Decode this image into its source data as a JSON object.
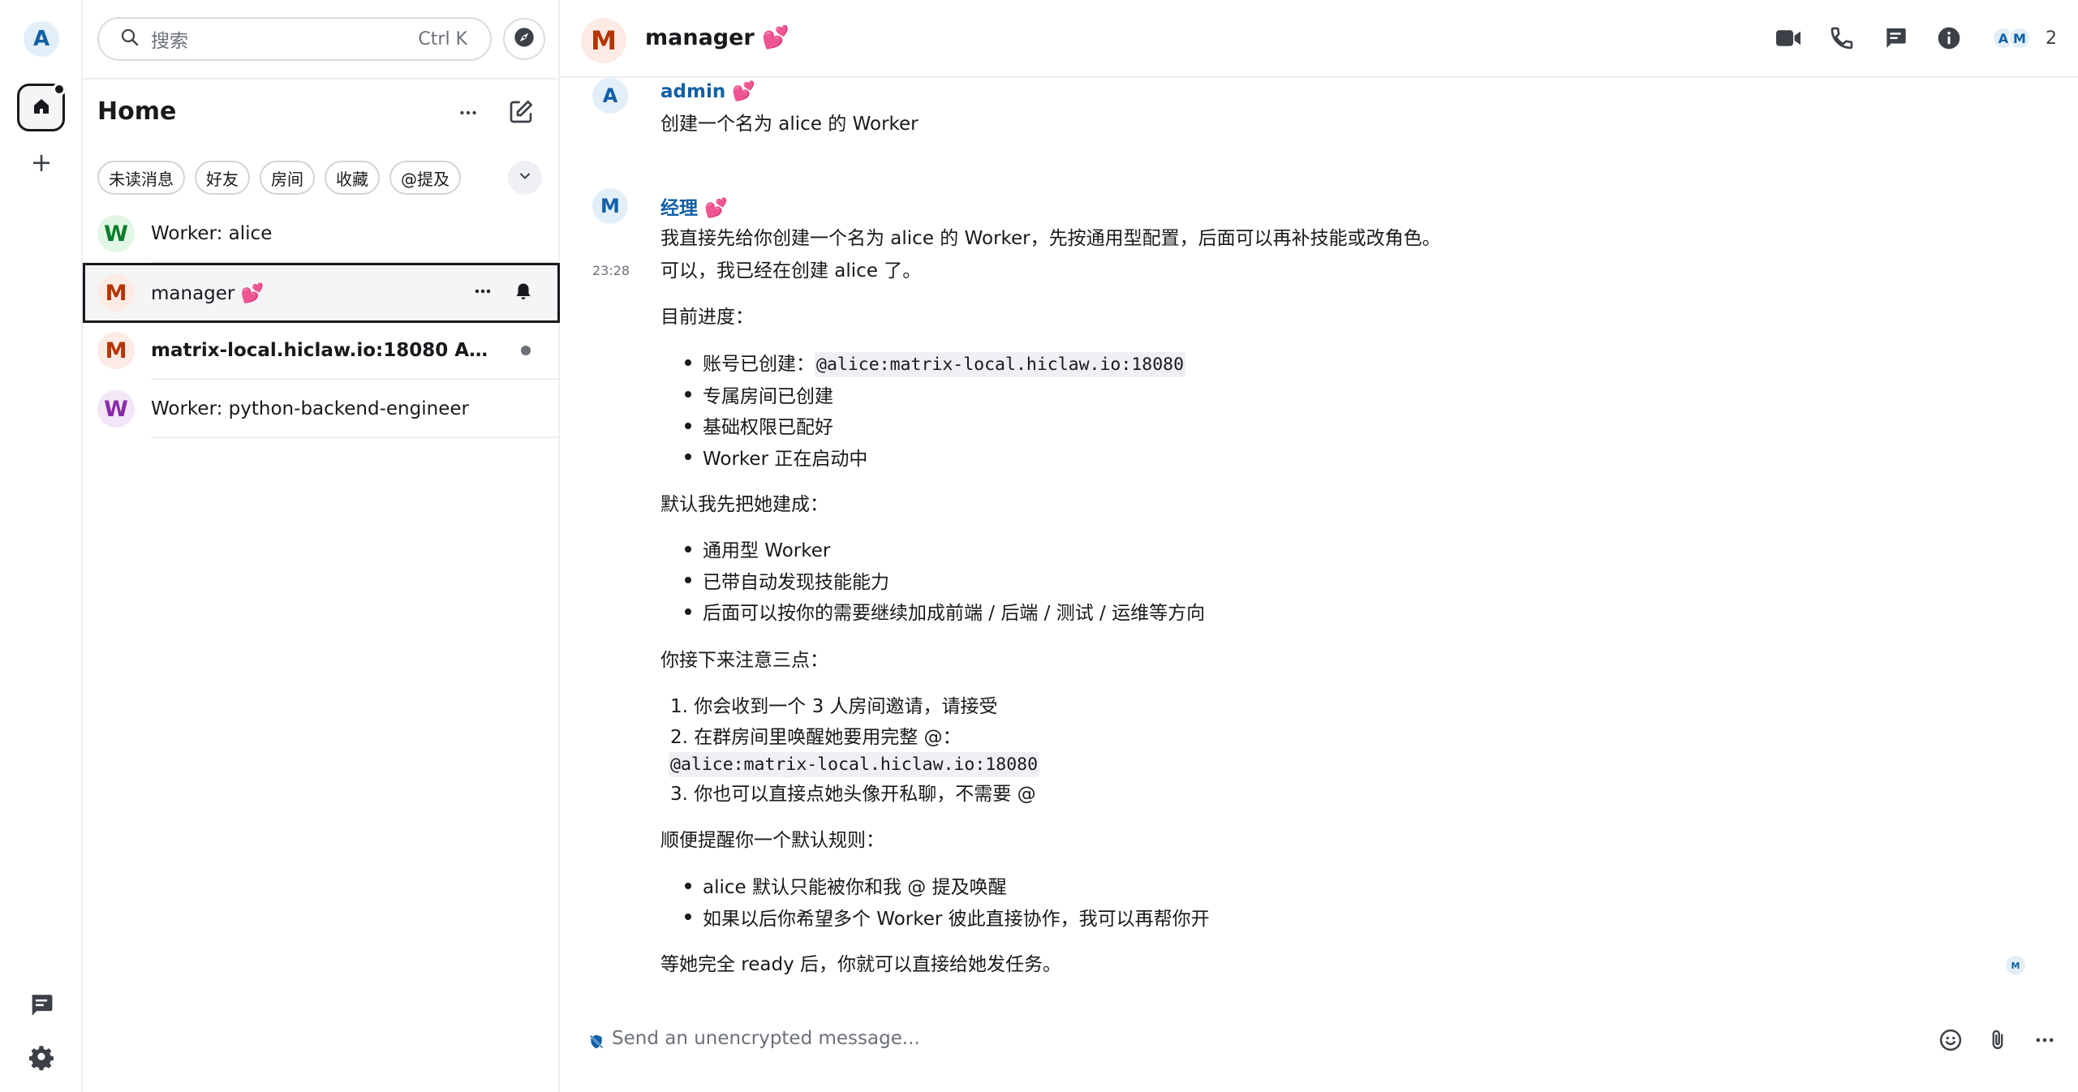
{
  "spacebar": {
    "user_initial": "A",
    "colors": {
      "user_avatar_bg": "#e2eff9",
      "user_avatar_fg": "#1160a5"
    }
  },
  "roomlist": {
    "search_placeholder": "搜索",
    "search_shortcut": "Ctrl K",
    "title": "Home",
    "filters": [
      "未读消息",
      "好友",
      "房间",
      "收藏",
      "@提及"
    ],
    "rooms": [
      {
        "initial": "W",
        "name": "Worker: alice",
        "avatar_bg": "#e2f6e5",
        "avatar_fg": "#0a7d2c"
      },
      {
        "initial": "M",
        "name": "manager 💕",
        "avatar_bg": "#fcebe4",
        "avatar_fg": "#b53400",
        "selected": true
      },
      {
        "initial": "M",
        "name": "matrix-local.hiclaw.io:18080 Admin R...",
        "avatar_bg": "#fcebe4",
        "avatar_fg": "#b53400",
        "bold": true,
        "unread": true
      },
      {
        "initial": "W",
        "name": "Worker: python-backend-engineer",
        "avatar_bg": "#f3e6f7",
        "avatar_fg": "#8a2aa8"
      }
    ]
  },
  "header": {
    "room_initial": "M",
    "room_name": "manager 💕",
    "member_initials": [
      "A",
      "M"
    ],
    "member_count": "2"
  },
  "timeline": {
    "msg1": {
      "initial": "A",
      "sender": "admin 💕",
      "text": "创建一个名为 alice 的 Worker"
    },
    "msg2": {
      "initial": "M",
      "sender": "经理 💕",
      "timestamp": "23:28",
      "line1": "我直接先给你创建一个名为 alice 的 Worker，先按通用型配置，后面可以再补技能或改角色。",
      "line2": "可以，我已经在创建 alice 了。",
      "progress_heading": "目前进度：",
      "progress_items": [
        {
          "text": "账号已创建：",
          "code": "@alice:matrix-local.hiclaw.io:18080"
        },
        {
          "text": "专属房间已创建"
        },
        {
          "text": "基础权限已配好"
        },
        {
          "text": "Worker 正在启动中"
        }
      ],
      "default_heading": "默认我先把她建成：",
      "default_items": [
        "通用型 Worker",
        "已带自动发现技能能力",
        "后面可以按你的需要继续加成前端 / 后端 / 测试 / 运维等方向"
      ],
      "notes_heading": "你接下来注意三点：",
      "note1": "1. 你会收到一个 3 人房间邀请，请接受",
      "note2": "2. 在群房间里唤醒她要用完整 @：",
      "note2_code": "@alice:matrix-local.hiclaw.io:18080",
      "note3": "3. 你也可以直接点她头像开私聊，不需要 @",
      "rules_heading": "顺便提醒你一个默认规则：",
      "rules_items": [
        "alice 默认只能被你和我 @ 提及唤醒",
        "如果以后你希望多个 Worker 彼此直接协作，我可以再帮你开"
      ],
      "closing": "等她完全 ready 后，你就可以直接给她发任务。",
      "read_receipt_initial": "M"
    }
  },
  "composer": {
    "placeholder": "Send an unencrypted message..."
  },
  "colors": {
    "accent_blue": "#1160a5",
    "text_primary": "#17191c",
    "text_secondary": "#6b7079",
    "divider": "#eceef1",
    "code_bg": "#eef0f3"
  }
}
